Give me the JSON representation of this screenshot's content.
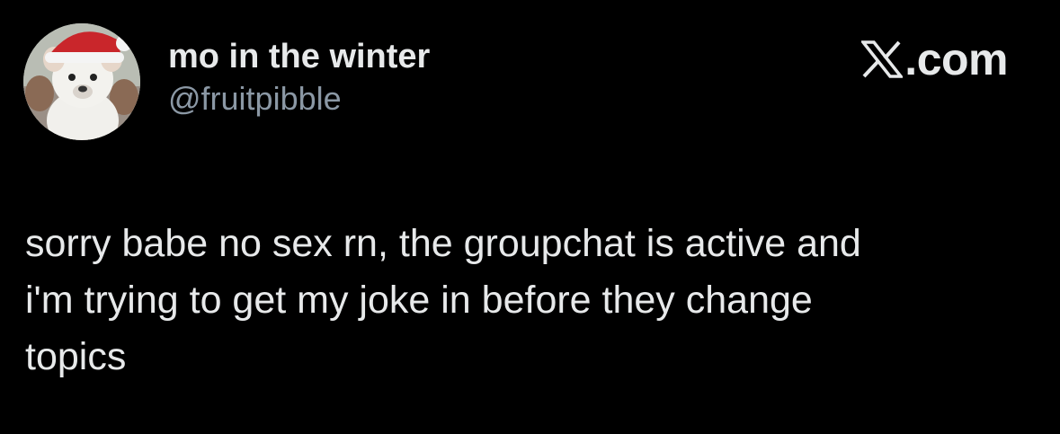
{
  "author": {
    "display_name": "mo in the winter",
    "handle": "@fruitpibble",
    "avatar_icon": "puppy-santa-hat-avatar"
  },
  "brand": {
    "icon": "x-logo-icon",
    "text": ".com"
  },
  "tweet": {
    "text": "sorry babe no sex rn, the groupchat is active and\ni'm trying to get my joke in before they change\ntopics"
  },
  "colors": {
    "background": "#000000",
    "primary_text": "#e7e9ea",
    "secondary_text": "#8b98a5"
  }
}
